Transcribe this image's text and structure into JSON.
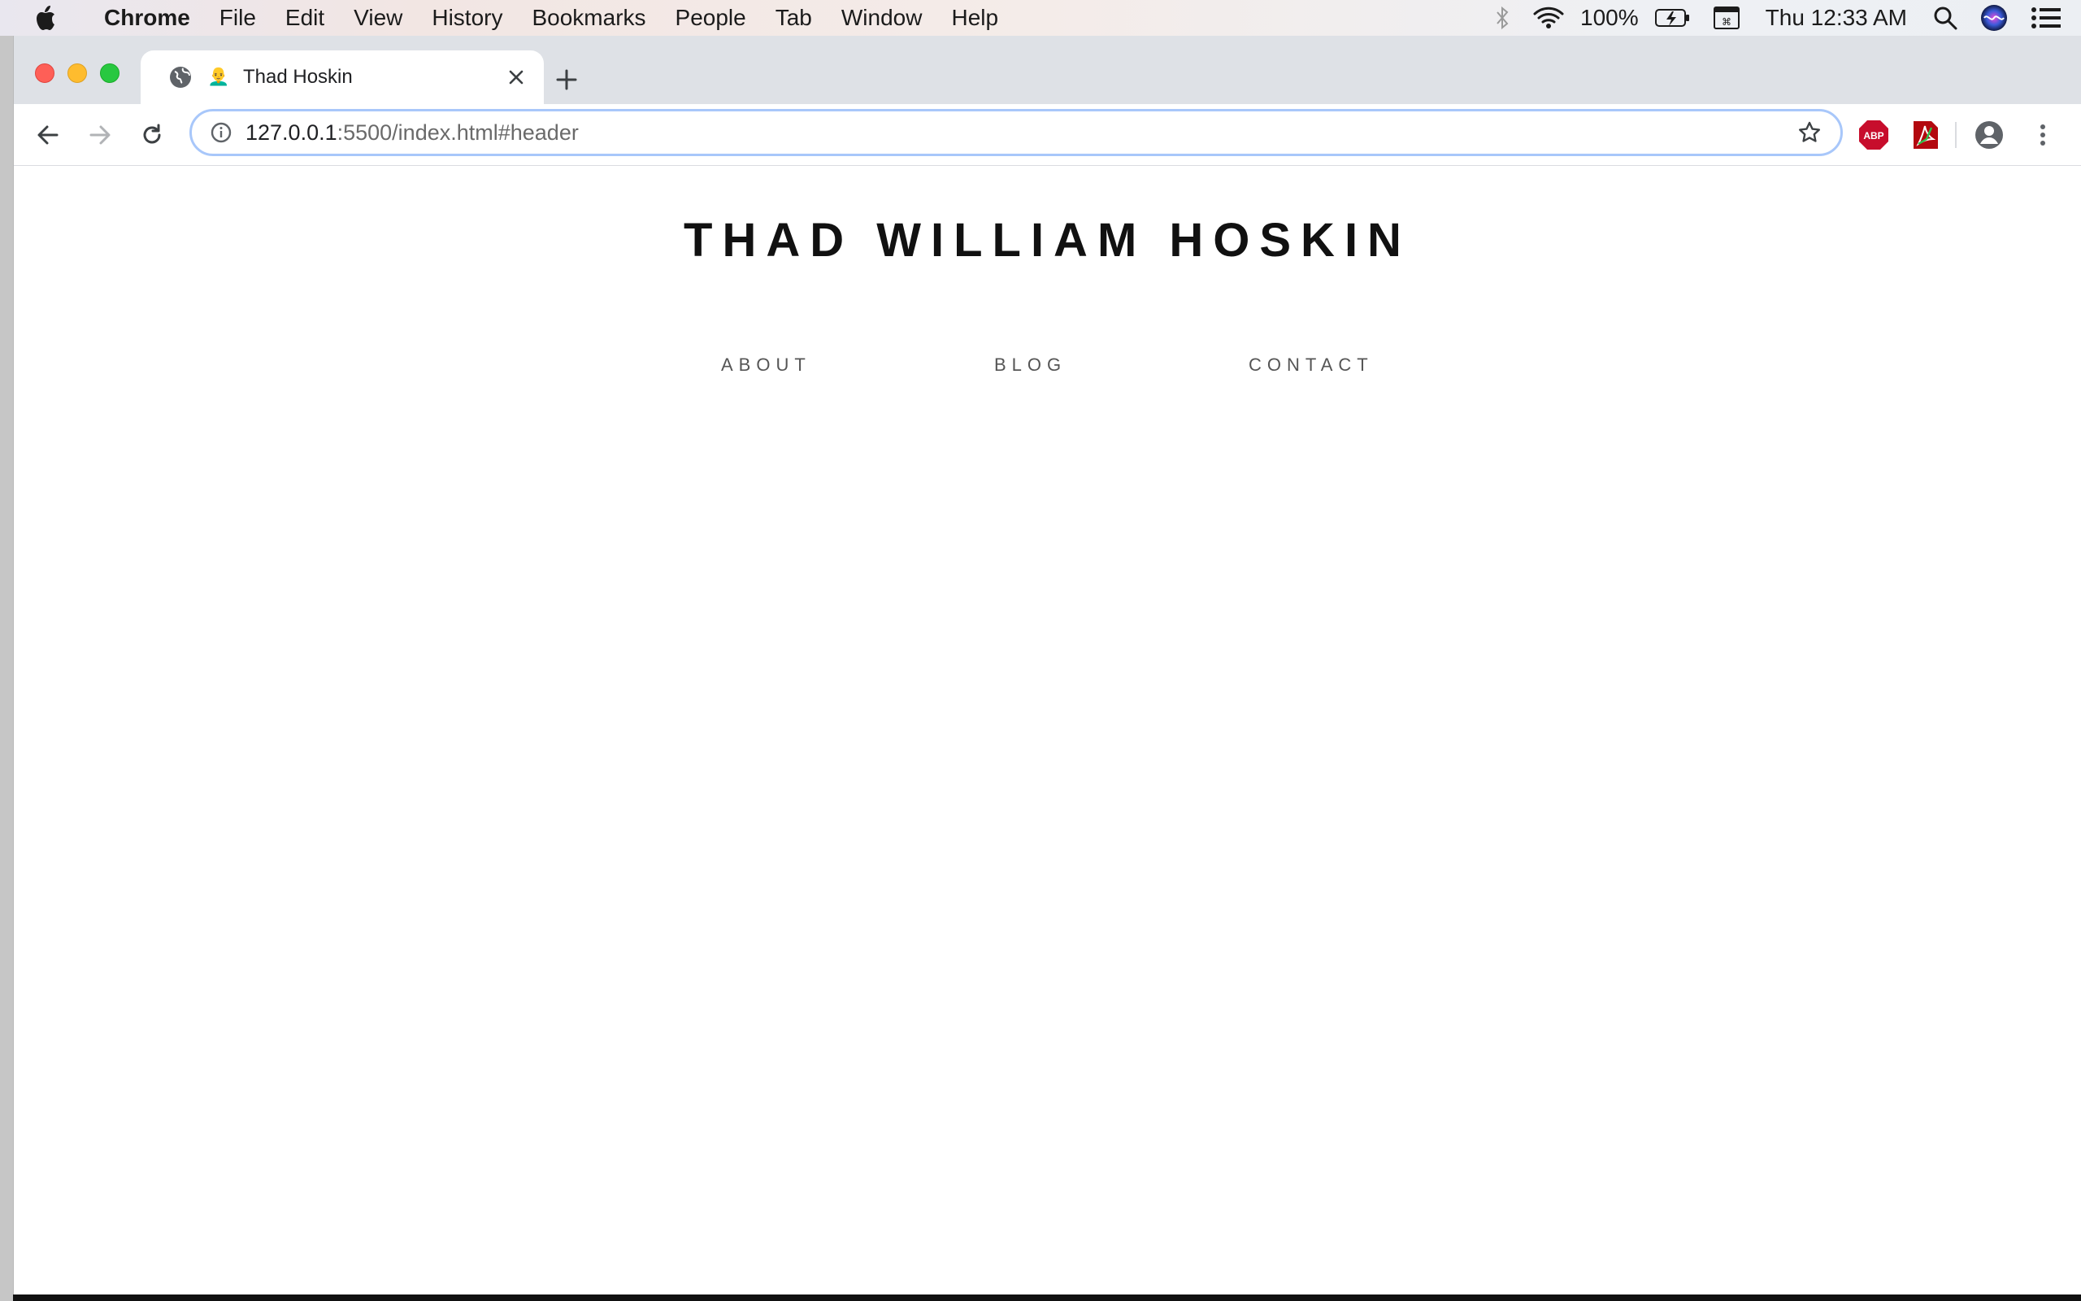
{
  "menubar": {
    "app_name": "Chrome",
    "items": [
      "File",
      "Edit",
      "View",
      "History",
      "Bookmarks",
      "People",
      "Tab",
      "Window",
      "Help"
    ],
    "battery_percent": "100%",
    "clock": "Thu 12:33 AM"
  },
  "browser": {
    "tab": {
      "title": "Thad Hoskin",
      "favicon_emoji": "👨‍🦲"
    },
    "omnibox": {
      "url_host": "127.0.0.1",
      "url_rest": ":5500/index.html#header"
    },
    "extensions": {
      "abp_label": "ABP"
    }
  },
  "page": {
    "site_title": "THAD WILLIAM HOSKIN",
    "nav": {
      "about": "ABOUT",
      "blog": "BLOG",
      "contact": "CONTACT"
    }
  },
  "colors": {
    "tab_strip": "#dee1e6",
    "omnibox_focus": "#a8c7fa",
    "title_text": "#111111",
    "nav_text": "#555555",
    "abp_red": "#c70d2c"
  }
}
